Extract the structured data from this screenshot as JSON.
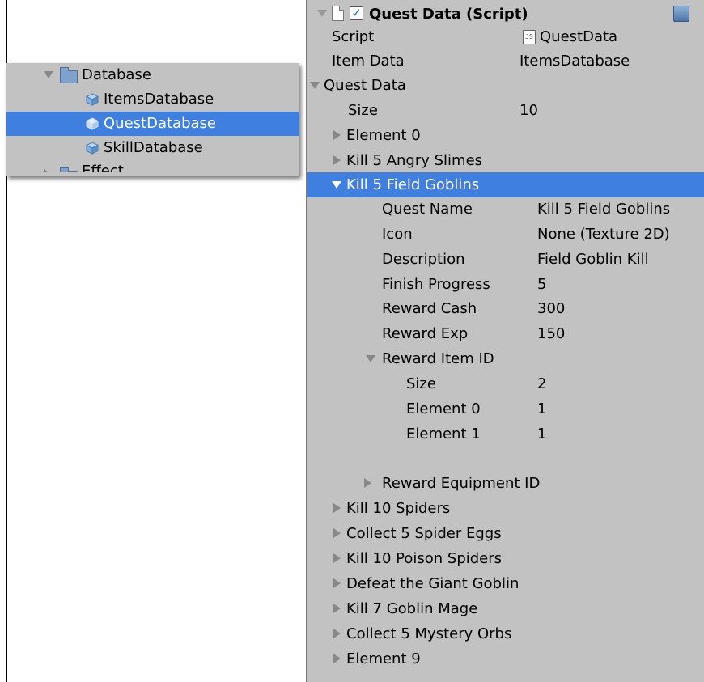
{
  "project_panel": {
    "items": [
      {
        "label": "Database",
        "expanded": true,
        "icon": "folder-icon"
      },
      {
        "label": "ItemsDatabase",
        "icon": "asset-cube-icon"
      },
      {
        "label": "QuestDatabase",
        "icon": "asset-cube-icon",
        "selected": true
      },
      {
        "label": "SkillDatabase",
        "icon": "asset-cube-icon"
      },
      {
        "label": "Effect",
        "icon": "folder-icon"
      }
    ]
  },
  "inspector": {
    "component_title": "Quest Data (Script)",
    "script": {
      "label": "Script",
      "value": "QuestData"
    },
    "item_data": {
      "label": "Item Data",
      "value": "ItemsDatabase"
    },
    "quest_data_label": "Quest Data",
    "size": {
      "label": "Size",
      "value": "10"
    },
    "elements": [
      {
        "label": "Element 0"
      },
      {
        "label": "Kill 5 Angry Slimes"
      },
      {
        "label": "Kill 5 Field Goblins",
        "expanded": true,
        "selected": true
      },
      {
        "label": "Kill 10 Spiders"
      },
      {
        "label": "Collect 5 Spider Eggs"
      },
      {
        "label": "Kill 10 Poison Spiders"
      },
      {
        "label": "Defeat the Giant Goblin"
      },
      {
        "label": "Kill 7 Goblin Mage"
      },
      {
        "label": "Collect 5 Mystery Orbs"
      },
      {
        "label": "Element 9"
      }
    ],
    "expanded_element": {
      "fields": [
        {
          "label": "Quest Name",
          "value": "Kill 5 Field Goblins"
        },
        {
          "label": "Icon",
          "value": "None (Texture 2D)"
        },
        {
          "label": "Description",
          "value": "Field Goblin Kill"
        },
        {
          "label": "Finish Progress",
          "value": "5"
        },
        {
          "label": "Reward Cash",
          "value": "300"
        },
        {
          "label": "Reward Exp",
          "value": "150"
        }
      ],
      "reward_item_id": {
        "label": "Reward Item ID",
        "size": {
          "label": "Size",
          "value": "2"
        },
        "elements": [
          {
            "label": "Element 0",
            "value": "1"
          },
          {
            "label": "Element 1",
            "value": "1"
          }
        ]
      },
      "reward_equipment_id": {
        "label": "Reward Equipment ID"
      }
    }
  },
  "colors": {
    "selection": "#3f7fe0",
    "panel_bg": "#c2c2c2"
  }
}
